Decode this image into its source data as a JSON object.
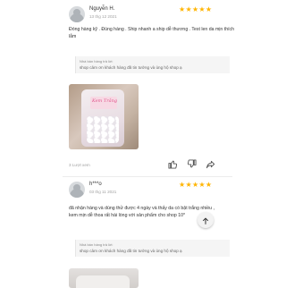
{
  "reviews": [
    {
      "username": "Nguyễn H.",
      "date": "13 thg 12 2021",
      "rating": 5,
      "stars": "★★★★★",
      "text": "Đóng hàng kỹ . Đúng hàng . Ship nhanh a ship dễ thương . Test len da mịn thích lắm",
      "reply_label": "Nhà bán hàng trả lời:",
      "reply_text": "shop cảm ơn khách hàng đã tin tưởng và ủng hộ shop ạ",
      "photo_caption": "Kem Trắng",
      "views": "3 Lượt xem"
    },
    {
      "username": "h***o",
      "date": "03 thg 11 2021",
      "rating": 5,
      "stars": "★★★★★",
      "text": "đã nhận hàng và dùng thử được 4 ngày và thấy da có bật trắng nhiều , kem mịn dễ thoa rất hài lòng với sản phẩm cho shop 10*",
      "reply_label": "Nhà bán hàng trả lời:",
      "reply_text": "shop cảm ơn khách hàng đã tin tưởng và ủng hộ shop ạ"
    }
  ],
  "icons": {
    "like": "thumbs-up-icon",
    "dislike": "thumbs-down-icon",
    "share": "share-icon",
    "back_to_top": "arrow-up-icon"
  },
  "colors": {
    "star": "#ffb400"
  }
}
